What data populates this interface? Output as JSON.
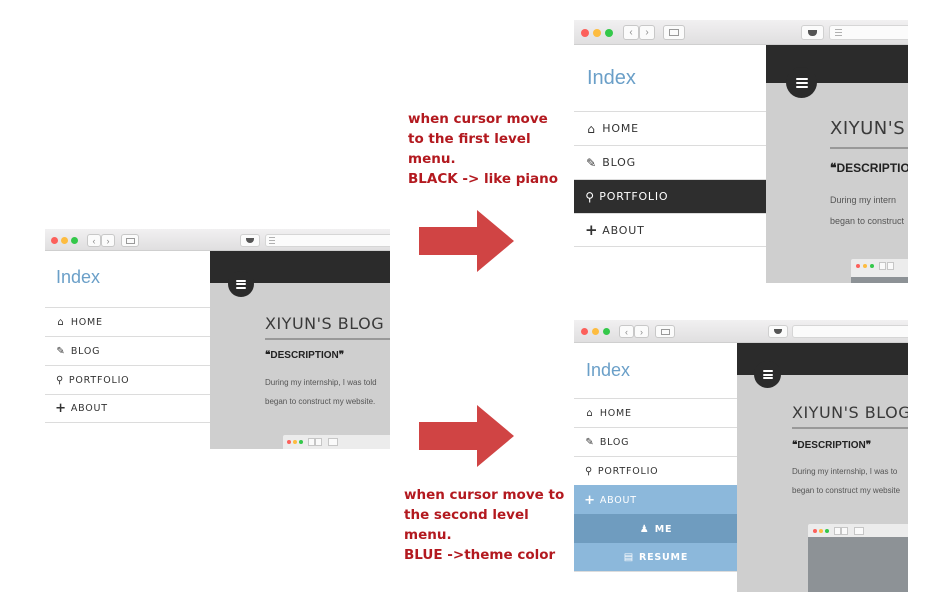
{
  "brand": "Index",
  "menu": {
    "home": "HOME",
    "blog": "BLOG",
    "portfolio": "PORTFOLIO",
    "about": "ABOUT",
    "me": "ME",
    "resume": "RESUME"
  },
  "content": {
    "title": "XIYUN'S BLOG",
    "title_cut": "XIYUN'S",
    "desc": "DESCRIPTION",
    "desc_cut": "DESCRIPTIO",
    "para_line1": "During my internship, I was told",
    "para_line2": "began to construct my website.",
    "para_line1_b": "During my intern",
    "para_line2_b": "began to construct",
    "para_line1_c": "During my internship, I was to",
    "para_line2_c": "began to construct my website"
  },
  "notes": {
    "first": [
      "when cursor move",
      "to the first level",
      "menu.",
      "BLACK -> like piano"
    ],
    "second": [
      "when cursor move to",
      "the second level",
      "menu.",
      "BLUE ->theme color"
    ]
  },
  "icons": {
    "home": "home-icon",
    "blog": "pencil-icon",
    "portfolio": "lightbulb-icon",
    "about": "plus-icon",
    "me": "user-icon",
    "resume": "file-icon",
    "menu": "hamburger-icon",
    "quote": "quote-icon"
  },
  "colors": {
    "index": "#6a9fc8",
    "active_black": "#2e2e2e",
    "theme_blue": "#8cb8db",
    "sub_blue": "#6f9cbf",
    "note_text": "#b3191f",
    "arrow": "#d04444"
  }
}
